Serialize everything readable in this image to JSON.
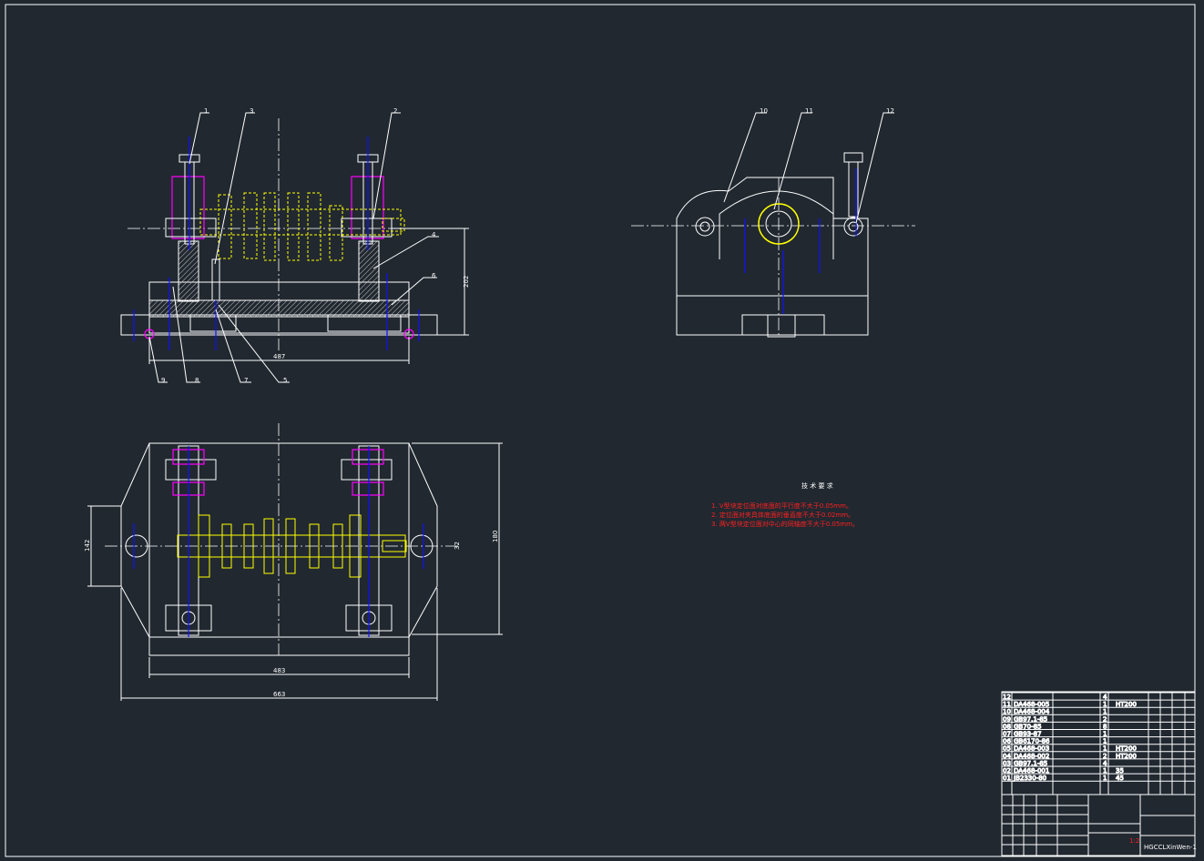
{
  "colors": {
    "background": "#212830",
    "outline": "#ffffff",
    "workpiece": "#ffff00",
    "clamp": "#ff00ff",
    "centerline": "#1010ff",
    "annotation": "#ff2020"
  },
  "front_view": {
    "balloons": [
      "1",
      "3",
      "2",
      "4",
      "6",
      "9",
      "8",
      "7",
      "5"
    ],
    "dims": {
      "width": "487",
      "height": "202"
    }
  },
  "side_view": {
    "balloons": [
      "10",
      "11",
      "12"
    ]
  },
  "plan_view": {
    "dims": {
      "inner_width": "483",
      "overall_width": "663",
      "ear_height": "142",
      "depth": "180",
      "shaft": "32"
    }
  },
  "tech_req": {
    "title": "技 术 要 求",
    "items": [
      "1. V型块定位面对底面的平行度不大于0.05mm。",
      "2. 定位面对夹具体底面的垂直度不大于0.02mm。",
      "3. 两V型块定位面对中心的同轴度不大于0.05mm。"
    ]
  },
  "bom": {
    "rows": [
      [
        "12",
        "",
        "",
        "4",
        ""
      ],
      [
        "11",
        "DA468-005",
        "",
        "1",
        "HT200"
      ],
      [
        "10",
        "DA468-004",
        "",
        "1",
        ""
      ],
      [
        "09",
        "GB97.1-85",
        "",
        "2",
        ""
      ],
      [
        "08",
        "GB70-85",
        "",
        "8",
        ""
      ],
      [
        "07",
        "GB93-87",
        "",
        "1",
        ""
      ],
      [
        "06",
        "GB6170-86",
        "",
        "1",
        ""
      ],
      [
        "05",
        "DA468-003",
        "",
        "1",
        "HT200"
      ],
      [
        "04",
        "DA468-002",
        "",
        "2",
        "HT200"
      ],
      [
        "03",
        "GB97.1-85",
        "",
        "4",
        ""
      ],
      [
        "02",
        "DA468-001",
        "",
        "1",
        "35"
      ],
      [
        "01",
        "JB2330-80",
        "",
        "1",
        "45"
      ]
    ]
  },
  "title_block": {
    "scale": "1:2",
    "drawing_no": "HGCCLXinWen-1"
  }
}
